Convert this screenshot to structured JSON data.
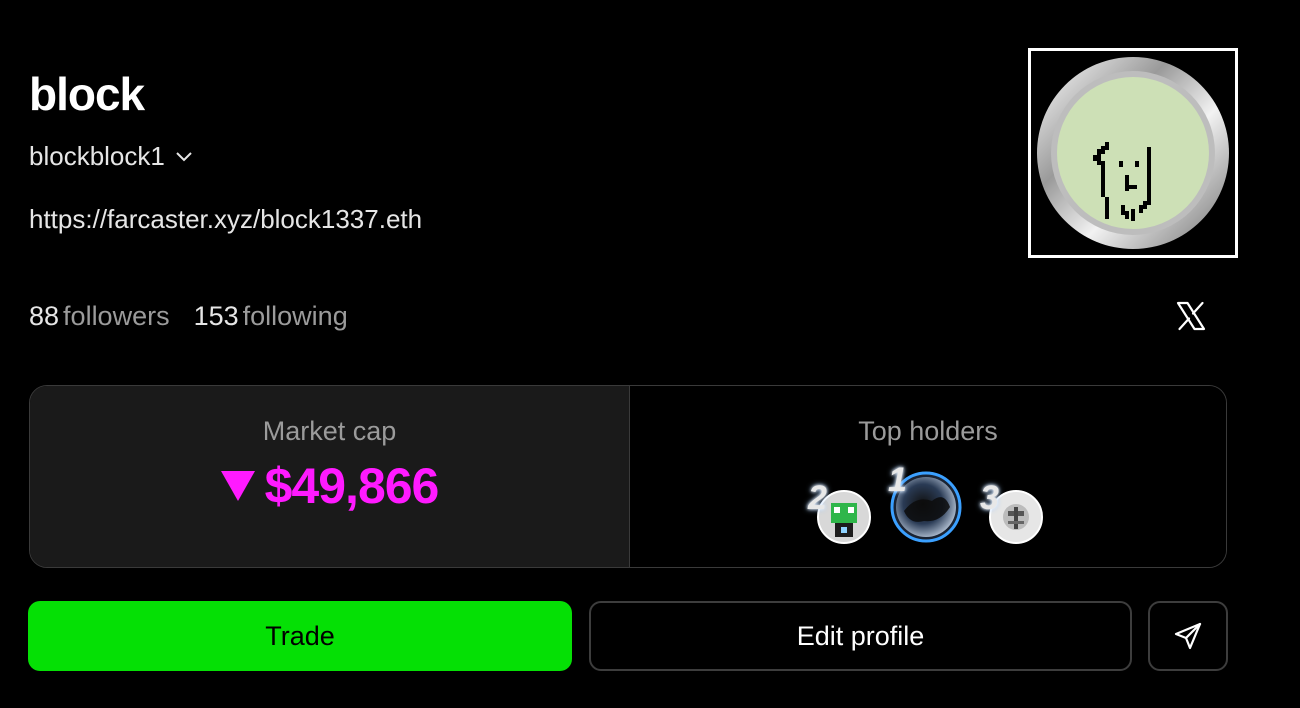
{
  "profile": {
    "display_name": "block",
    "username": "blockblock1",
    "link": "https://farcaster.xyz/block1337.eth",
    "followers_count": "88",
    "followers_label": "followers",
    "following_count": "153",
    "following_label": "following"
  },
  "market": {
    "title": "Market cap",
    "value": "$49,866",
    "trend": "down",
    "trend_color": "#ff1aff"
  },
  "holders": {
    "title": "Top holders",
    "items": [
      {
        "rank": "2",
        "icon": "frog-avatar-icon"
      },
      {
        "rank": "1",
        "icon": "smoke-avatar-icon"
      },
      {
        "rank": "3",
        "icon": "mask-avatar-icon"
      }
    ]
  },
  "actions": {
    "trade_label": "Trade",
    "edit_label": "Edit profile",
    "share_icon": "send-icon"
  },
  "colors": {
    "trade_green": "#05e005",
    "background": "#000000",
    "card_bg": "#1a1a1a"
  }
}
